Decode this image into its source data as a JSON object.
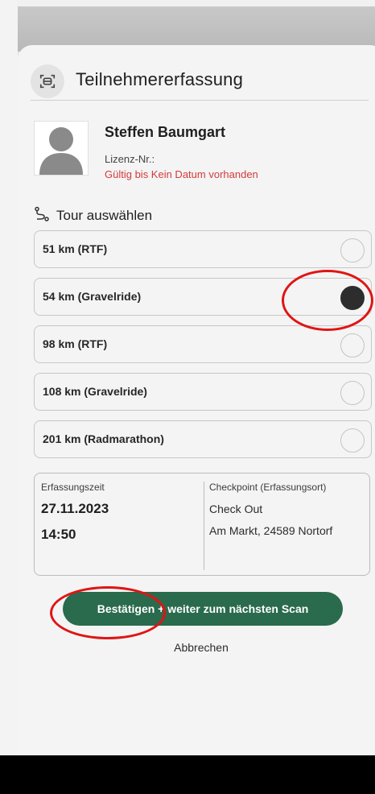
{
  "header": {
    "title": "Teilnehmererfassung",
    "icon": "scan-icon"
  },
  "participant": {
    "name": "Steffen Baumgart",
    "license_label": "Lizenz-Nr.:",
    "validity_text": "Gültig bis Kein Datum vorhanden",
    "validity_color": "#d43b3b"
  },
  "tour": {
    "title": "Tour auswählen",
    "icon": "route-icon",
    "options": [
      {
        "label": "51 km (RTF)",
        "selected": false
      },
      {
        "label": "54 km (Gravelride)",
        "selected": true
      },
      {
        "label": "98 km (RTF)",
        "selected": false
      },
      {
        "label": "108 km (Gravelride)",
        "selected": false
      },
      {
        "label": "201 km (Radmarathon)",
        "selected": false
      }
    ]
  },
  "capture": {
    "time_label": "Erfassungszeit",
    "date": "27.11.2023",
    "time": "14:50",
    "checkpoint_label": "Checkpoint (Erfassungsort)",
    "checkpoint_name": "Check Out",
    "checkpoint_address": "Am Markt, 24589 Nortorf"
  },
  "actions": {
    "confirm_label": "Bestätigen + weiter zum nächsten Scan",
    "cancel_label": "Abbrechen"
  },
  "colors": {
    "accent": "#2a6a4d",
    "annotation": "#e01414"
  }
}
